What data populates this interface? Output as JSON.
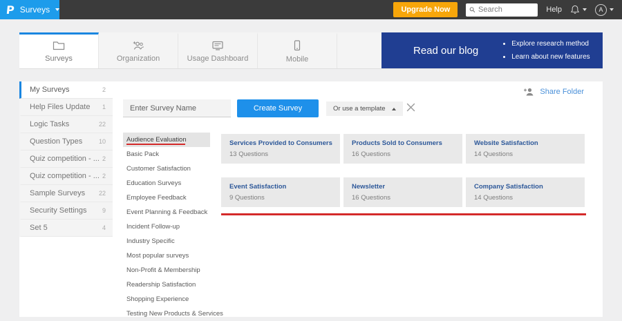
{
  "topbar": {
    "logo": "P",
    "app_menu": "Surveys",
    "upgrade_label": "Upgrade Now",
    "search_placeholder": "Search",
    "help_label": "Help",
    "avatar_initial": "A"
  },
  "tabs": [
    {
      "label": "Surveys",
      "icon": "folder-icon",
      "active": true
    },
    {
      "label": "Organization",
      "icon": "people-plus-icon",
      "active": false
    },
    {
      "label": "Usage Dashboard",
      "icon": "monitor-icon",
      "active": false
    },
    {
      "label": "Mobile",
      "icon": "phone-icon",
      "active": false
    }
  ],
  "blog_banner": {
    "title": "Read our blog",
    "bullets": [
      "Explore research method",
      "Learn about new features"
    ]
  },
  "sidebar": {
    "items": [
      {
        "label": "My Surveys",
        "count": "2",
        "active": true
      },
      {
        "label": "Help Files Update",
        "count": "1",
        "active": false
      },
      {
        "label": "Logic Tasks",
        "count": "22",
        "active": false
      },
      {
        "label": "Question Types",
        "count": "10",
        "active": false
      },
      {
        "label": "Quiz competition - ...",
        "count": "2",
        "active": false
      },
      {
        "label": "Quiz competition - ...",
        "count": "2",
        "active": false
      },
      {
        "label": "Sample Surveys",
        "count": "22",
        "active": false
      },
      {
        "label": "Security Settings",
        "count": "9",
        "active": false
      },
      {
        "label": "Set 5",
        "count": "4",
        "active": false
      }
    ]
  },
  "folder_actions": {
    "share_label": "Share Folder"
  },
  "create": {
    "name_placeholder": "Enter Survey Name",
    "create_button": "Create Survey",
    "template_dropdown": "Or use a template"
  },
  "categories": {
    "selected": "Audience Evaluation",
    "items": [
      "Audience Evaluation",
      "Basic Pack",
      "Customer Satisfaction",
      "Education Surveys",
      "Employee Feedback",
      "Event Planning & Feedback",
      "Incident Follow-up",
      "Industry Specific",
      "Most popular surveys",
      "Non-Profit & Membership",
      "Readership Satisfaction",
      "Shopping Experience",
      "Testing New Products & Services"
    ]
  },
  "templates": [
    {
      "title": "Services Provided to Consumers",
      "questions": "13 Questions"
    },
    {
      "title": "Products Sold to Consumers",
      "questions": "16 Questions"
    },
    {
      "title": "Website Satisfaction",
      "questions": "14 Questions"
    },
    {
      "title": "Event Satisfaction",
      "questions": "9 Questions"
    },
    {
      "title": "Newsletter",
      "questions": "16 Questions"
    },
    {
      "title": "Company Satisfaction",
      "questions": "14 Questions"
    }
  ],
  "colors": {
    "brand_blue": "#1d9ceb",
    "button_blue": "#1e90ea",
    "banner_navy": "#203e92",
    "upgrade_orange": "#f7a60a",
    "annotation_red": "#d42a2a",
    "link_blue": "#4a90d9",
    "topbar_dark": "#3b3b3b"
  }
}
